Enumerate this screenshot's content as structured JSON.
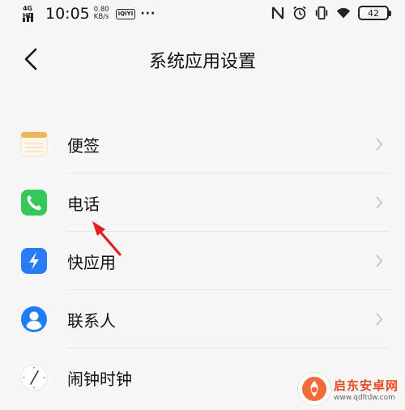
{
  "status_bar": {
    "network": "4G HD",
    "time": "10:05",
    "speed_value": "0.80",
    "speed_unit": "KB/s",
    "app_badge": "iQIYI",
    "more": "···",
    "battery": "42",
    "icons": [
      "nfc-icon",
      "alarm-icon",
      "vibrate-icon",
      "wifi-icon",
      "battery-icon"
    ]
  },
  "header": {
    "title": "系统应用设置",
    "back_icon": "back-chevron-icon"
  },
  "list": {
    "items": [
      {
        "label": "便签",
        "icon": "notes-icon",
        "icon_color": "#f2b65a"
      },
      {
        "label": "电话",
        "icon": "phone-icon",
        "icon_color": "#34c759"
      },
      {
        "label": "快应用",
        "icon": "quick-app-icon",
        "icon_color": "#2a7cf6"
      },
      {
        "label": "联系人",
        "icon": "contacts-icon",
        "icon_color": "#1f7ef5"
      },
      {
        "label": "闹钟时钟",
        "icon": "clock-icon",
        "icon_color": "#ffffff"
      }
    ]
  },
  "annotation": {
    "arrow_color": "#e02020"
  },
  "watermark": {
    "name": "启东安卓网",
    "url": "www.qdltdw.com"
  }
}
